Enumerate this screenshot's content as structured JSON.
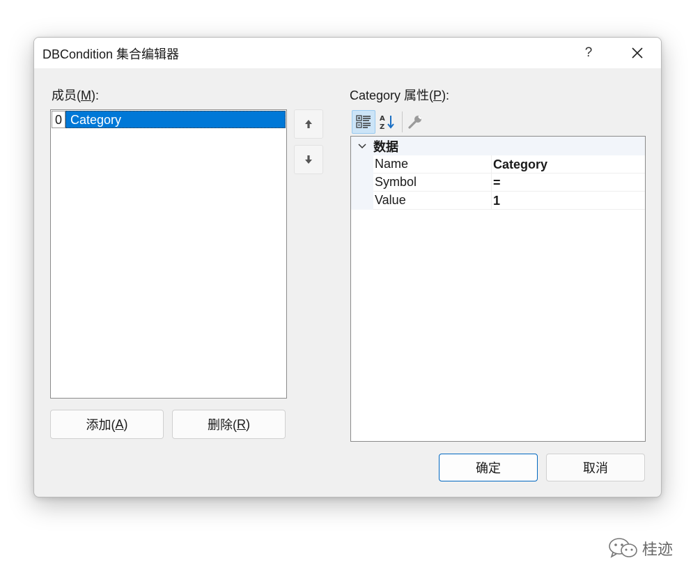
{
  "dialog": {
    "title": "DBCondition 集合编辑器",
    "help_glyph": "?"
  },
  "members": {
    "label": "成员(",
    "accel": "M",
    "label_end": "):",
    "items": [
      {
        "index": "0",
        "name": "Category",
        "selected": true
      }
    ],
    "move_up_label": "",
    "move_down_label": ""
  },
  "buttons": {
    "add_label": "添加(",
    "add_accel": "A",
    "add_end": ")",
    "remove_label": "删除(",
    "remove_accel": "R",
    "remove_end": ")",
    "ok_label": "确定",
    "cancel_label": "取消"
  },
  "properties": {
    "label": "Category 属性(",
    "accel": "P",
    "label_end": "):",
    "toolbar": [
      {
        "icon": "categorized-icon",
        "active": true
      },
      {
        "icon": "alphabetical-sort-icon",
        "active": false
      },
      {
        "icon": "property-pages-icon",
        "active": false
      }
    ],
    "category": "数据",
    "rows": [
      {
        "name": "Name",
        "value": "Category"
      },
      {
        "name": "Symbol",
        "value": "="
      },
      {
        "name": "Value",
        "value": "1"
      }
    ]
  },
  "watermark": {
    "text": "桂迹"
  },
  "colors": {
    "selection": "#0078d7",
    "primary_border": "#0067c0",
    "dialog_bg": "#f0f0f0"
  }
}
